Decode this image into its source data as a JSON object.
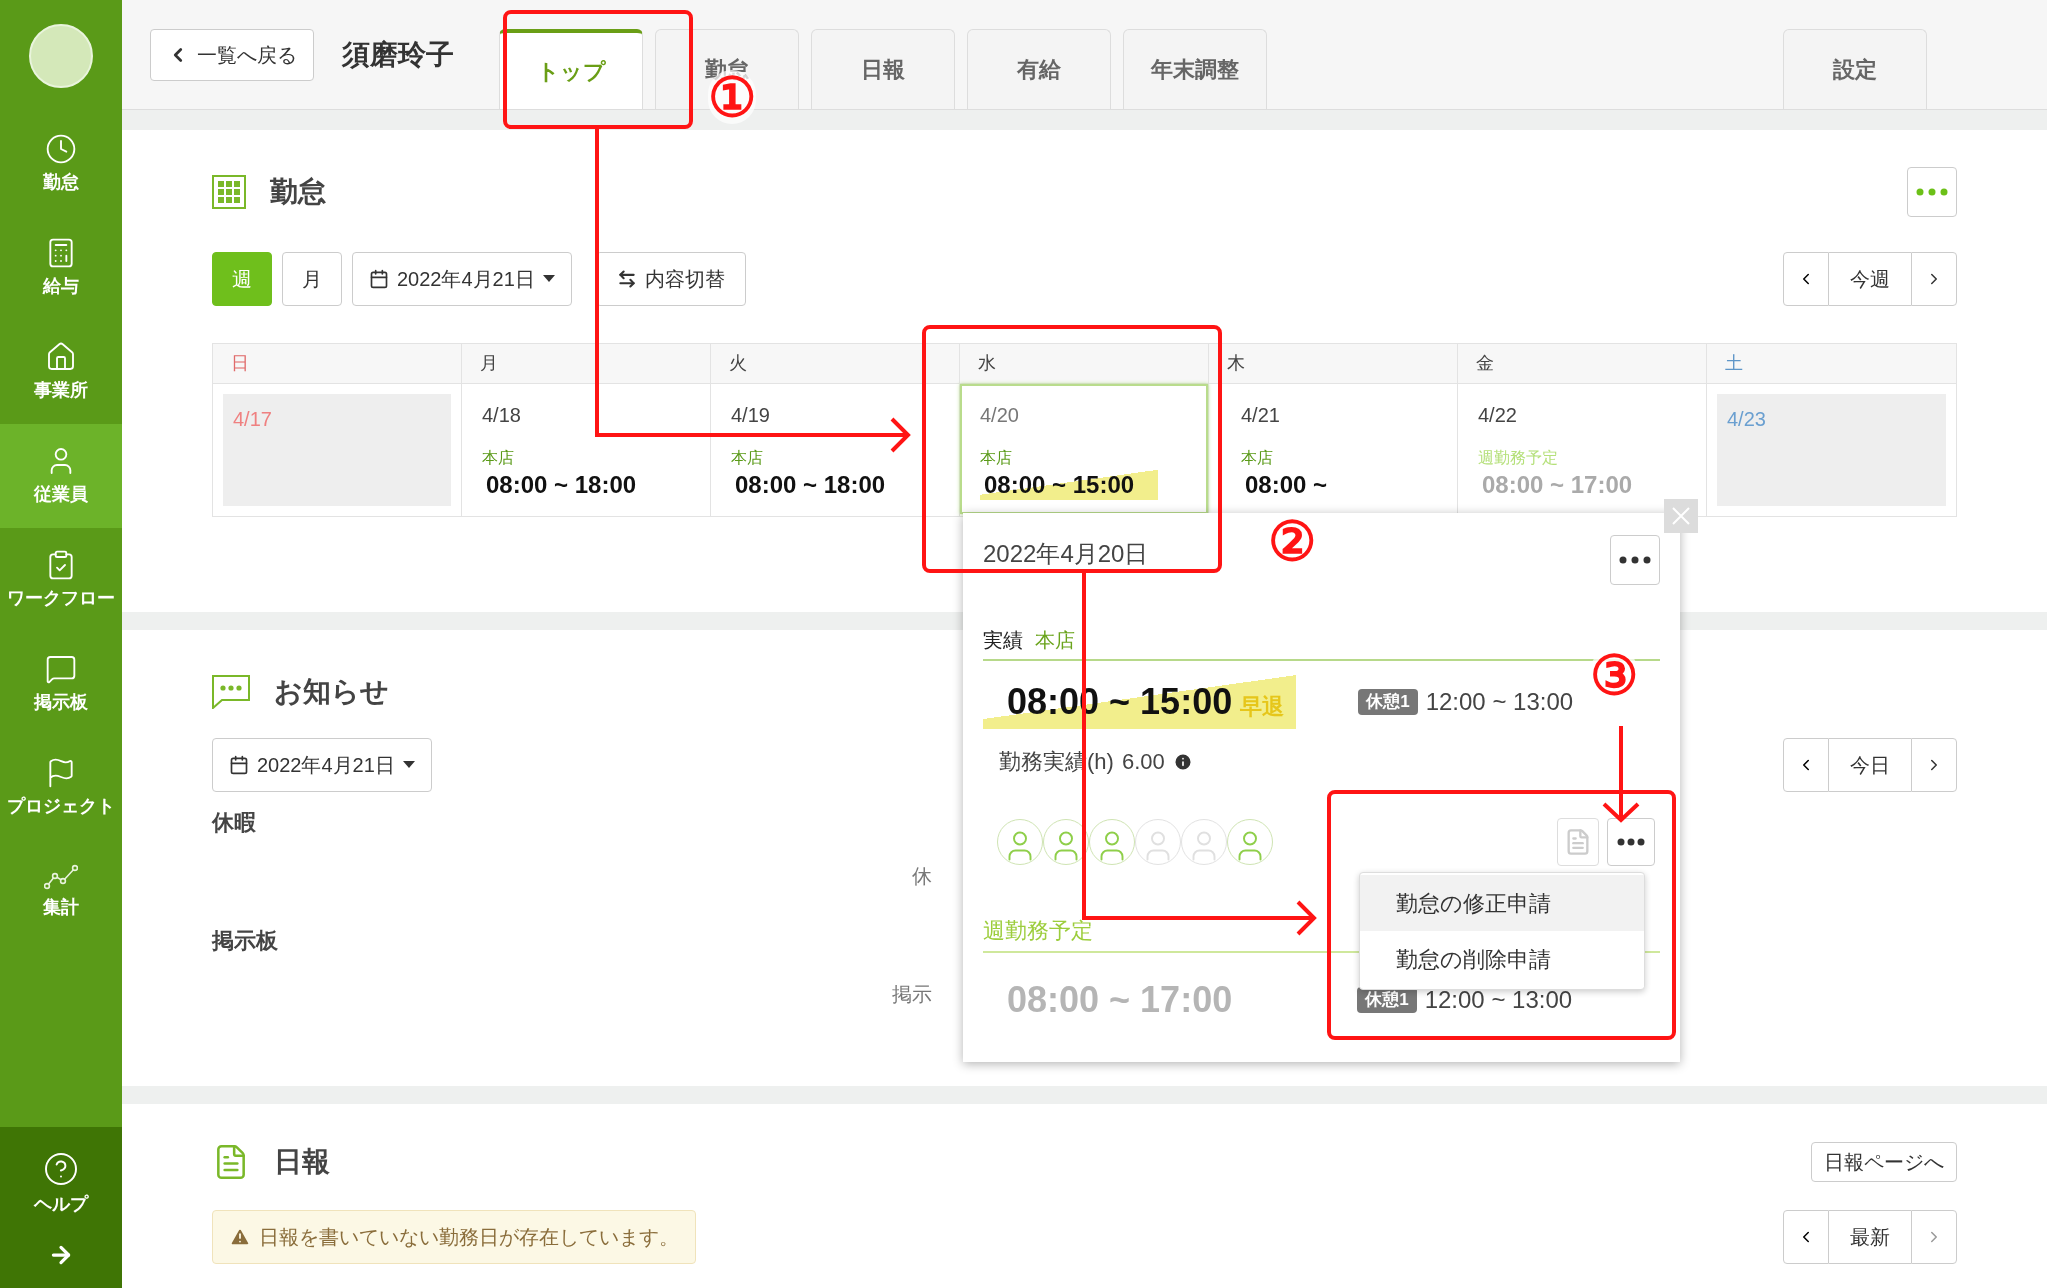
{
  "sidebar": {
    "items": [
      {
        "label": "勤怠",
        "selected": false
      },
      {
        "label": "給与",
        "selected": false
      },
      {
        "label": "事業所",
        "selected": false
      },
      {
        "label": "従業員",
        "selected": true
      },
      {
        "label": "ワークフロー",
        "selected": false
      },
      {
        "label": "掲示板",
        "selected": false
      },
      {
        "label": "プロジェクト",
        "selected": false
      },
      {
        "label": "集計",
        "selected": false
      }
    ],
    "help": "ヘルプ"
  },
  "header": {
    "back": "一覧へ戻る",
    "name": "須磨玲子",
    "tabs": [
      {
        "label": "トップ",
        "selected": true
      },
      {
        "label": "勤怠",
        "selected": false
      },
      {
        "label": "日報",
        "selected": false
      },
      {
        "label": "有給",
        "selected": false
      },
      {
        "label": "年末調整",
        "selected": false
      }
    ],
    "settings_tab": "設定"
  },
  "attendance": {
    "title": "勤怠",
    "views": [
      {
        "label": "週",
        "selected": true
      },
      {
        "label": "月",
        "selected": false
      }
    ],
    "date": "2022年4月21日",
    "switch": "内容切替",
    "nav": "今週",
    "days": [
      {
        "weekday": "日",
        "date": "4/17",
        "kind": "sunday",
        "selected": false
      },
      {
        "weekday": "月",
        "date": "4/18",
        "kind": "actual",
        "place": "本店",
        "time": "08:00 ~ 18:00",
        "selected": false
      },
      {
        "weekday": "火",
        "date": "4/19",
        "kind": "actual",
        "place": "本店",
        "time": "08:00 ~ 18:00",
        "selected": false
      },
      {
        "weekday": "水",
        "date": "4/20",
        "kind": "actual",
        "place": "本店",
        "time": "08:00 ~ 15:00",
        "selected": true
      },
      {
        "weekday": "木",
        "date": "4/21",
        "kind": "actual",
        "place": "本店",
        "time": "08:00 ~",
        "selected": false
      },
      {
        "weekday": "金",
        "date": "4/22",
        "kind": "scheduled",
        "place": "週勤務予定",
        "time": "08:00 ~ 17:00",
        "selected": false
      },
      {
        "weekday": "土",
        "date": "4/23",
        "kind": "saturday",
        "selected": false
      }
    ]
  },
  "popup": {
    "date": "2022年4月20日",
    "actual_label": "実績",
    "place": "本店",
    "time": "08:00 ~ 15:00",
    "badge": "早退",
    "break_label": "休憩1",
    "break_time": "12:00 ~ 13:00",
    "hours_label": "勤務実績(h)",
    "hours": "6.00",
    "avatars": [
      {
        "active": true
      },
      {
        "active": true
      },
      {
        "active": true
      },
      {
        "active": false
      },
      {
        "active": false
      },
      {
        "active": true
      }
    ],
    "menu": [
      {
        "label": "勤怠の修正申請",
        "selected": true
      },
      {
        "label": "勤怠の削除申請",
        "selected": false
      }
    ],
    "schedule_label": "週勤務予定",
    "schedule_time": "08:00 ~ 17:00",
    "schedule_break_label": "休憩1",
    "schedule_break_time": "12:00 ~ 13:00"
  },
  "notices": {
    "title": "お知らせ",
    "date": "2022年4月21日",
    "nav": "今日",
    "sections": [
      {
        "title": "休暇",
        "text": "休"
      },
      {
        "title": "掲示板",
        "text": "掲示"
      }
    ]
  },
  "daily": {
    "title": "日報",
    "link": "日報ページへ",
    "warning": "日報を書いていない勤務日が存在しています。",
    "nav": "最新"
  },
  "annotations": [
    {
      "label": "①"
    },
    {
      "label": "②"
    },
    {
      "label": "③"
    }
  ]
}
